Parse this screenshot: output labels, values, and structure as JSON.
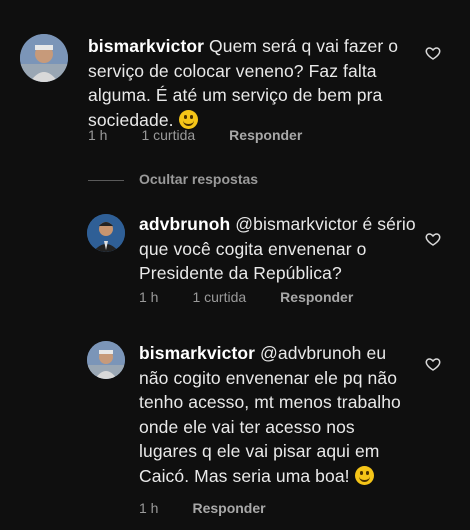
{
  "comments": [
    {
      "username": "bismarkvictor",
      "text": "Quem será q vai fazer o serviço de colocar veneno? Faz falta alguma. É até um serviço de bem pra sociedade.",
      "time": "1 h",
      "likes": "1 curtida",
      "reply": "Responder",
      "avatar_icon": "user-avatar",
      "emoji": "smiling-face-emoji"
    },
    {
      "username": "advbrunoh",
      "text": "@bismarkvictor é sério que você cogita envenenar o Presidente da República?",
      "time": "1 h",
      "likes": "1 curtida",
      "reply": "Responder",
      "avatar_icon": "user-avatar"
    },
    {
      "username": "bismarkvictor",
      "text": "@advbrunoh eu não cogito envenenar ele pq não tenho acesso, mt menos trabalho onde ele vai ter acesso nos lugares q ele vai pisar aqui em Caicó. Mas seria uma boa!",
      "time": "1 h",
      "reply": "Responder",
      "avatar_icon": "user-avatar",
      "emoji": "smiling-face-emoji"
    }
  ],
  "hide_replies": "Ocultar respostas",
  "icons": {
    "like": "heart-outline-icon"
  },
  "colors": {
    "background": "#0f0f0f",
    "text": "#e9e9e9",
    "muted": "#9a9a9a"
  }
}
